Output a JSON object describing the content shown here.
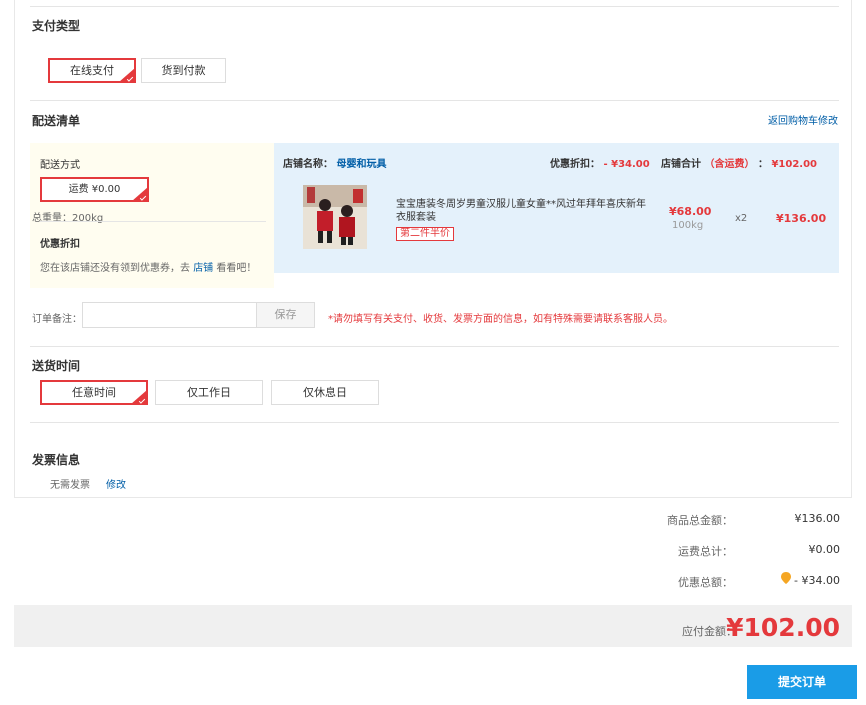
{
  "payment": {
    "title": "支付类型",
    "options": [
      "在线支付",
      "货到付款"
    ],
    "selected_index": 0
  },
  "delivery_list": {
    "title": "配送清单",
    "back_link": "返回购物车修改"
  },
  "shipping": {
    "method_label": "配送方式",
    "fee_option": "运费 ¥0.00",
    "total_weight": "总重量：200kg",
    "discount_label": "优惠折扣",
    "coupon_prefix": "您在该店铺还没有领到优惠券，去",
    "coupon_link": "店铺",
    "coupon_suffix": "看看吧！"
  },
  "shop": {
    "name_label": "店铺名称：",
    "name": "母婴和玩具",
    "discount_label": "优惠折扣：",
    "discount_value": "- ¥34.00",
    "total_label_a": "店铺合计",
    "total_label_b": "（含运费）",
    "total_label_c": "：",
    "total_value": "¥102.00"
  },
  "product": {
    "title_line1": "宝宝唐装冬周岁男童汉服儿童女童**风过年拜年喜庆新年",
    "title_line2": "衣服套装",
    "promo": "第二件半价",
    "price": "¥68.00",
    "weight": "100kg",
    "qty": "x2",
    "subtotal": "¥136.00"
  },
  "note": {
    "label": "订单备注：",
    "placeholder": "",
    "save_label": "保存",
    "hint": "*请勿填写有关支付、收货、发票方面的信息，如有特殊需要请联系客服人员。"
  },
  "delivery_time": {
    "title": "送货时间",
    "options": [
      "任意时间",
      "仅工作日",
      "仅休息日"
    ],
    "selected_index": 0
  },
  "invoice": {
    "title": "发票信息",
    "value": "无需发票",
    "edit_link": "修改"
  },
  "summary": {
    "goods_label": "商品总金额：",
    "goods_value": "¥136.00",
    "freight_label": "运费总计：",
    "freight_value": "¥0.00",
    "discount_label": "优惠总额：",
    "discount_value": "- ¥34.00",
    "payable_label": "应付金额：",
    "payable_value": "¥102.00"
  },
  "submit_label": "提交订单",
  "colors": {
    "accent_red": "#e4393c",
    "link_blue": "#005ea7",
    "submit_blue": "#1a9ce7",
    "shop_bg": "#e4f1fb",
    "ship_bg": "#fffdf0",
    "coupon_icon": "#f5a623"
  }
}
